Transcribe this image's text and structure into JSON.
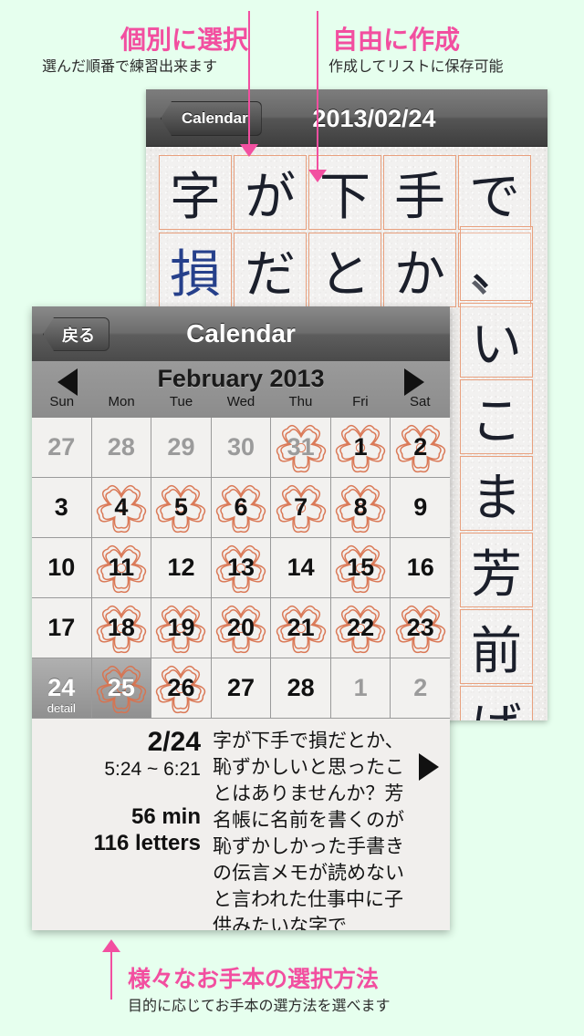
{
  "annotations": {
    "top_left": {
      "title": "個別に選択",
      "subtitle": "選んだ順番で練習出来ます"
    },
    "top_right": {
      "title": "自由に作成",
      "subtitle": "作成してリストに保存可能"
    },
    "bottom": {
      "title": "様々なお手本の選択方法",
      "subtitle": "目的に応じてお手本の選方法を選べます"
    },
    "accent_color": "#f24fa0",
    "background_color": "#e6ffee"
  },
  "practice_screen": {
    "back_button": "Calendar",
    "title": "2013/02/24",
    "grid_rows": [
      [
        "字",
        "が",
        "下",
        "手",
        "で"
      ],
      [
        "損",
        "だ",
        "と",
        "か",
        "、"
      ]
    ],
    "right_column": [
      "、",
      "い",
      "こ",
      "ま",
      "芳",
      "前",
      "ば"
    ]
  },
  "calendar": {
    "back_button": "戻る",
    "title": "Calendar",
    "month_label": "February 2013",
    "prev_icon": "triangle-left-icon",
    "next_icon": "triangle-right-icon",
    "day_headers": [
      "Sun",
      "Mon",
      "Tue",
      "Wed",
      "Thu",
      "Fri",
      "Sat"
    ],
    "selected_day": 24,
    "detail_tag": "detail",
    "stamp_color": "#d9734f",
    "weeks": [
      [
        {
          "n": "27",
          "muted": true,
          "stamp": false
        },
        {
          "n": "28",
          "muted": true,
          "stamp": false
        },
        {
          "n": "29",
          "muted": true,
          "stamp": false
        },
        {
          "n": "30",
          "muted": true,
          "stamp": false
        },
        {
          "n": "31",
          "muted": true,
          "stamp": true
        },
        {
          "n": "1",
          "muted": false,
          "stamp": true
        },
        {
          "n": "2",
          "muted": false,
          "stamp": true
        }
      ],
      [
        {
          "n": "3",
          "muted": false,
          "stamp": false
        },
        {
          "n": "4",
          "muted": false,
          "stamp": true
        },
        {
          "n": "5",
          "muted": false,
          "stamp": true
        },
        {
          "n": "6",
          "muted": false,
          "stamp": true
        },
        {
          "n": "7",
          "muted": false,
          "stamp": true
        },
        {
          "n": "8",
          "muted": false,
          "stamp": true
        },
        {
          "n": "9",
          "muted": false,
          "stamp": false
        }
      ],
      [
        {
          "n": "10",
          "muted": false,
          "stamp": false
        },
        {
          "n": "11",
          "muted": false,
          "stamp": true
        },
        {
          "n": "12",
          "muted": false,
          "stamp": false
        },
        {
          "n": "13",
          "muted": false,
          "stamp": true
        },
        {
          "n": "14",
          "muted": false,
          "stamp": false
        },
        {
          "n": "15",
          "muted": false,
          "stamp": true
        },
        {
          "n": "16",
          "muted": false,
          "stamp": false
        }
      ],
      [
        {
          "n": "17",
          "muted": false,
          "stamp": false
        },
        {
          "n": "18",
          "muted": false,
          "stamp": true
        },
        {
          "n": "19",
          "muted": false,
          "stamp": true
        },
        {
          "n": "20",
          "muted": false,
          "stamp": true
        },
        {
          "n": "21",
          "muted": false,
          "stamp": true
        },
        {
          "n": "22",
          "muted": false,
          "stamp": true
        },
        {
          "n": "23",
          "muted": false,
          "stamp": true
        }
      ],
      [
        {
          "n": "24",
          "muted": false,
          "stamp": false,
          "selected": true,
          "tag": "detail"
        },
        {
          "n": "25",
          "muted": false,
          "stamp": true,
          "selected": true
        },
        {
          "n": "26",
          "muted": false,
          "stamp": true
        },
        {
          "n": "27",
          "muted": false,
          "stamp": false
        },
        {
          "n": "28",
          "muted": false,
          "stamp": false
        },
        {
          "n": "1",
          "muted": true,
          "stamp": false
        },
        {
          "n": "2",
          "muted": true,
          "stamp": false
        }
      ]
    ],
    "detail": {
      "date": "2/24",
      "time_range": "5:24 ~ 6:21",
      "duration": "56 min",
      "letters": "116 letters",
      "text": "字が下手で損だとか、恥ずかしいと思ったことはありませんか？芳名帳に名前を書くのが恥ずかしかった手書きの伝言メモが読めないと言われた仕事中に子供みたいな字で",
      "next_icon": "triangle-right-icon"
    }
  }
}
